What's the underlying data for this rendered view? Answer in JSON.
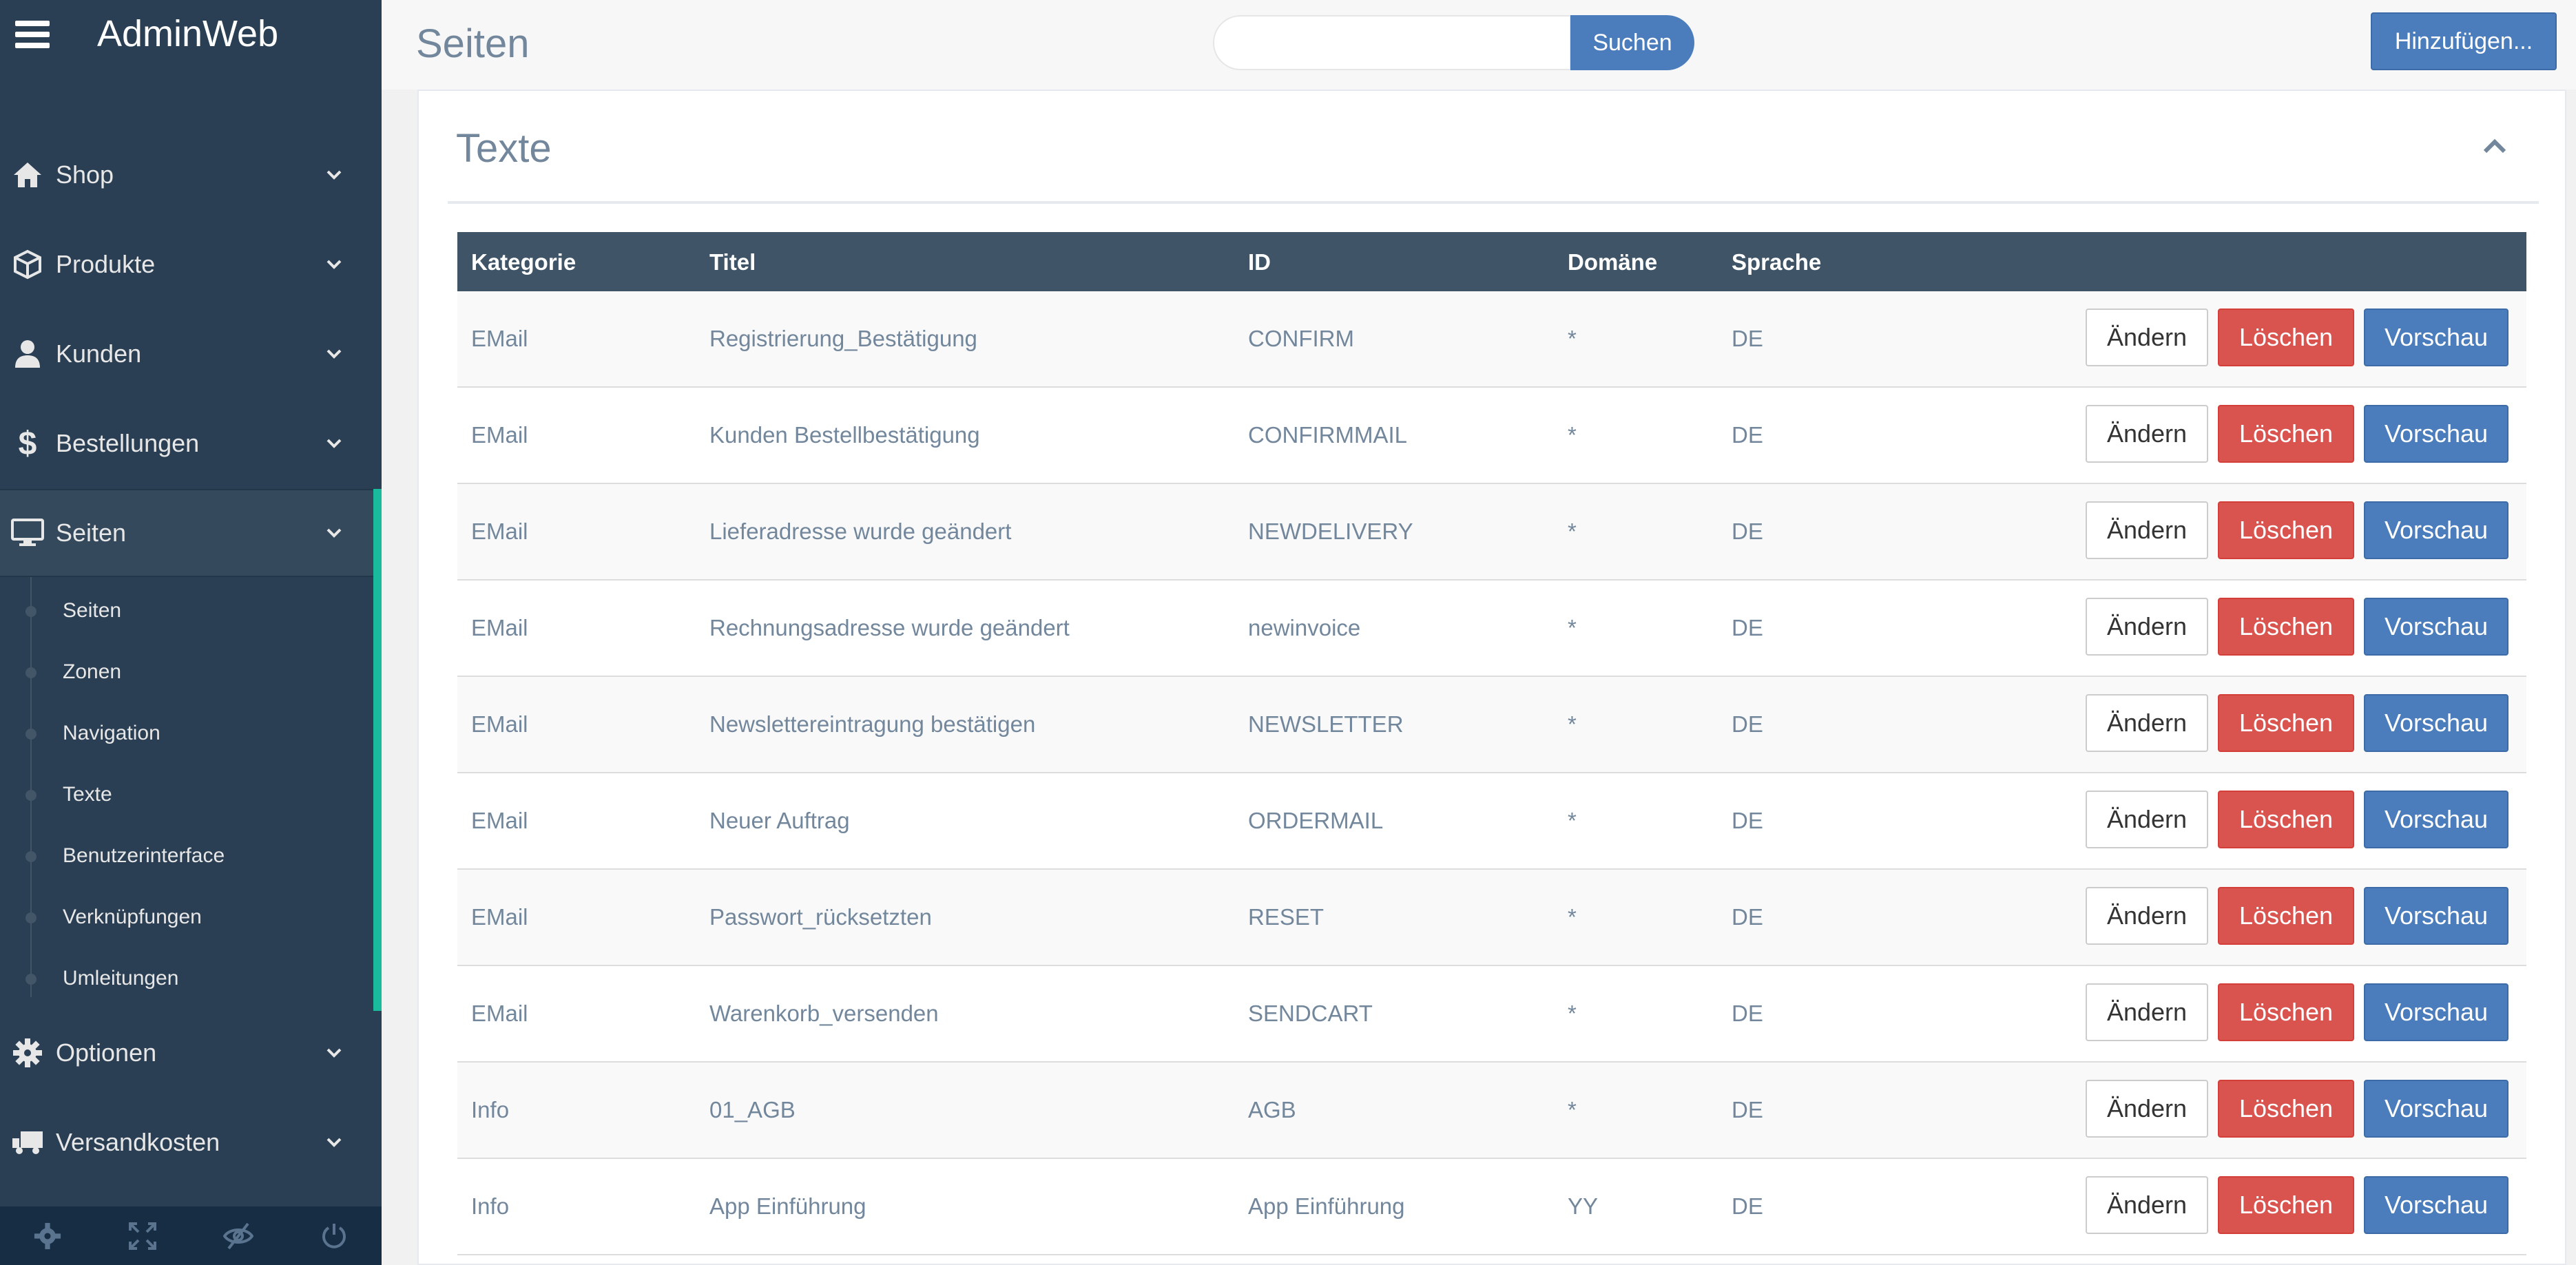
{
  "sidebar": {
    "brand": "AdminWeb",
    "menu": [
      {
        "label": "Shop",
        "icon": "home-icon"
      },
      {
        "label": "Produkte",
        "icon": "cube-icon"
      },
      {
        "label": "Kunden",
        "icon": "user-icon"
      },
      {
        "label": "Bestellungen",
        "icon": "dollar-icon"
      },
      {
        "label": "Seiten",
        "icon": "desktop-icon"
      },
      {
        "label": "Optionen",
        "icon": "gear-icon"
      },
      {
        "label": "Versandkosten",
        "icon": "truck-icon"
      }
    ],
    "submenu": [
      "Seiten",
      "Zonen",
      "Navigation",
      "Texte",
      "Benutzerinterface",
      "Verknüpfungen",
      "Umleitungen"
    ],
    "footer": [
      "settings-icon",
      "fullscreen-icon",
      "eye-slash-icon",
      "power-icon"
    ]
  },
  "header": {
    "title": "Seiten",
    "search_placeholder": "",
    "search_label": "Suchen",
    "add_label": "Hinzufügen..."
  },
  "panel": {
    "title": "Texte"
  },
  "table": {
    "columns": [
      "Kategorie",
      "Titel",
      "ID",
      "Domäne",
      "Sprache"
    ],
    "actions": {
      "edit": "Ändern",
      "delete": "Löschen",
      "preview": "Vorschau"
    },
    "rows": [
      [
        "EMail",
        "Registrierung_Bestätigung",
        "CONFIRM",
        "*",
        "DE"
      ],
      [
        "EMail",
        "Kunden Bestellbestätigung",
        "CONFIRMMAIL",
        "*",
        "DE"
      ],
      [
        "EMail",
        "Lieferadresse wurde geändert",
        "NEWDELIVERY",
        "*",
        "DE"
      ],
      [
        "EMail",
        "Rechnungsadresse wurde geändert",
        "newinvoice",
        "*",
        "DE"
      ],
      [
        "EMail",
        "Newslettereintragung bestätigen",
        "NEWSLETTER",
        "*",
        "DE"
      ],
      [
        "EMail",
        "Neuer Auftrag",
        "ORDERMAIL",
        "*",
        "DE"
      ],
      [
        "EMail",
        "Passwort_rücksetzten",
        "RESET",
        "*",
        "DE"
      ],
      [
        "EMail",
        "Warenkorb_versenden",
        "SENDCART",
        "*",
        "DE"
      ],
      [
        "Info",
        "01_AGB",
        "AGB",
        "*",
        "DE"
      ],
      [
        "Info",
        "App Einführung",
        "App Einführung",
        "YY",
        "DE"
      ]
    ]
  },
  "colors": {
    "sidebar": "#2a3f54",
    "accent": "#1abb9c",
    "primary": "#4b7dbd",
    "danger": "#d9534f",
    "table_header": "#405467"
  }
}
